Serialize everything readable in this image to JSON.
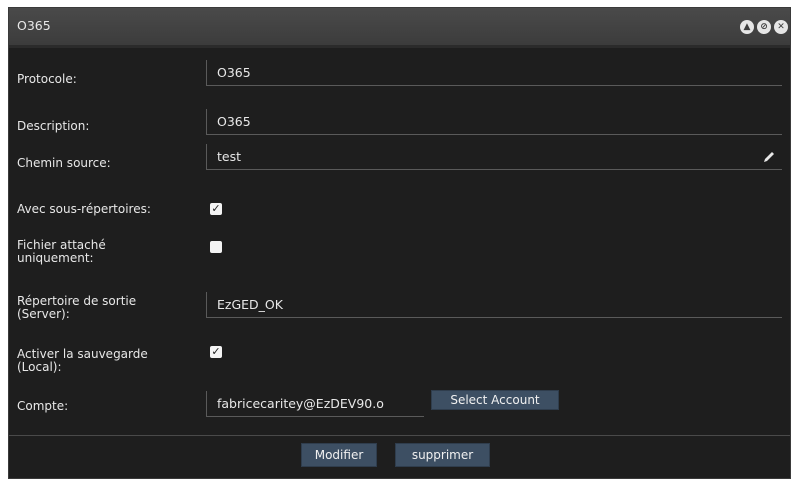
{
  "window": {
    "title": "O365"
  },
  "form": {
    "protocole": {
      "label": "Protocole:",
      "value": "O365"
    },
    "description": {
      "label": "Description:",
      "value": "O365"
    },
    "chemin_source": {
      "label": "Chemin source:",
      "value": "test"
    },
    "avec_sous_repertoires": {
      "label": "Avec sous-répertoires:",
      "checked": true
    },
    "fichier_attache": {
      "label_line1": "Fichier attaché",
      "label_line2": "uniquement:",
      "checked": false
    },
    "repertoire_sortie": {
      "label_line1": "Répertoire de sortie",
      "label_line2": "(Server):",
      "value": "EzGED_OK"
    },
    "activer_sauvegarde": {
      "label_line1": "Activer la sauvegarde",
      "label_line2": "(Local):",
      "checked": true
    },
    "compte": {
      "label": "Compte:",
      "value": "fabricecaritey@EzDEV90.o",
      "select_label": "Select Account"
    }
  },
  "actions": {
    "modify_label": "Modifier",
    "delete_label": "supprimer"
  },
  "colors": {
    "background": "#1e1e1e",
    "button": "#3d4f63",
    "titlebar": "#444444"
  }
}
